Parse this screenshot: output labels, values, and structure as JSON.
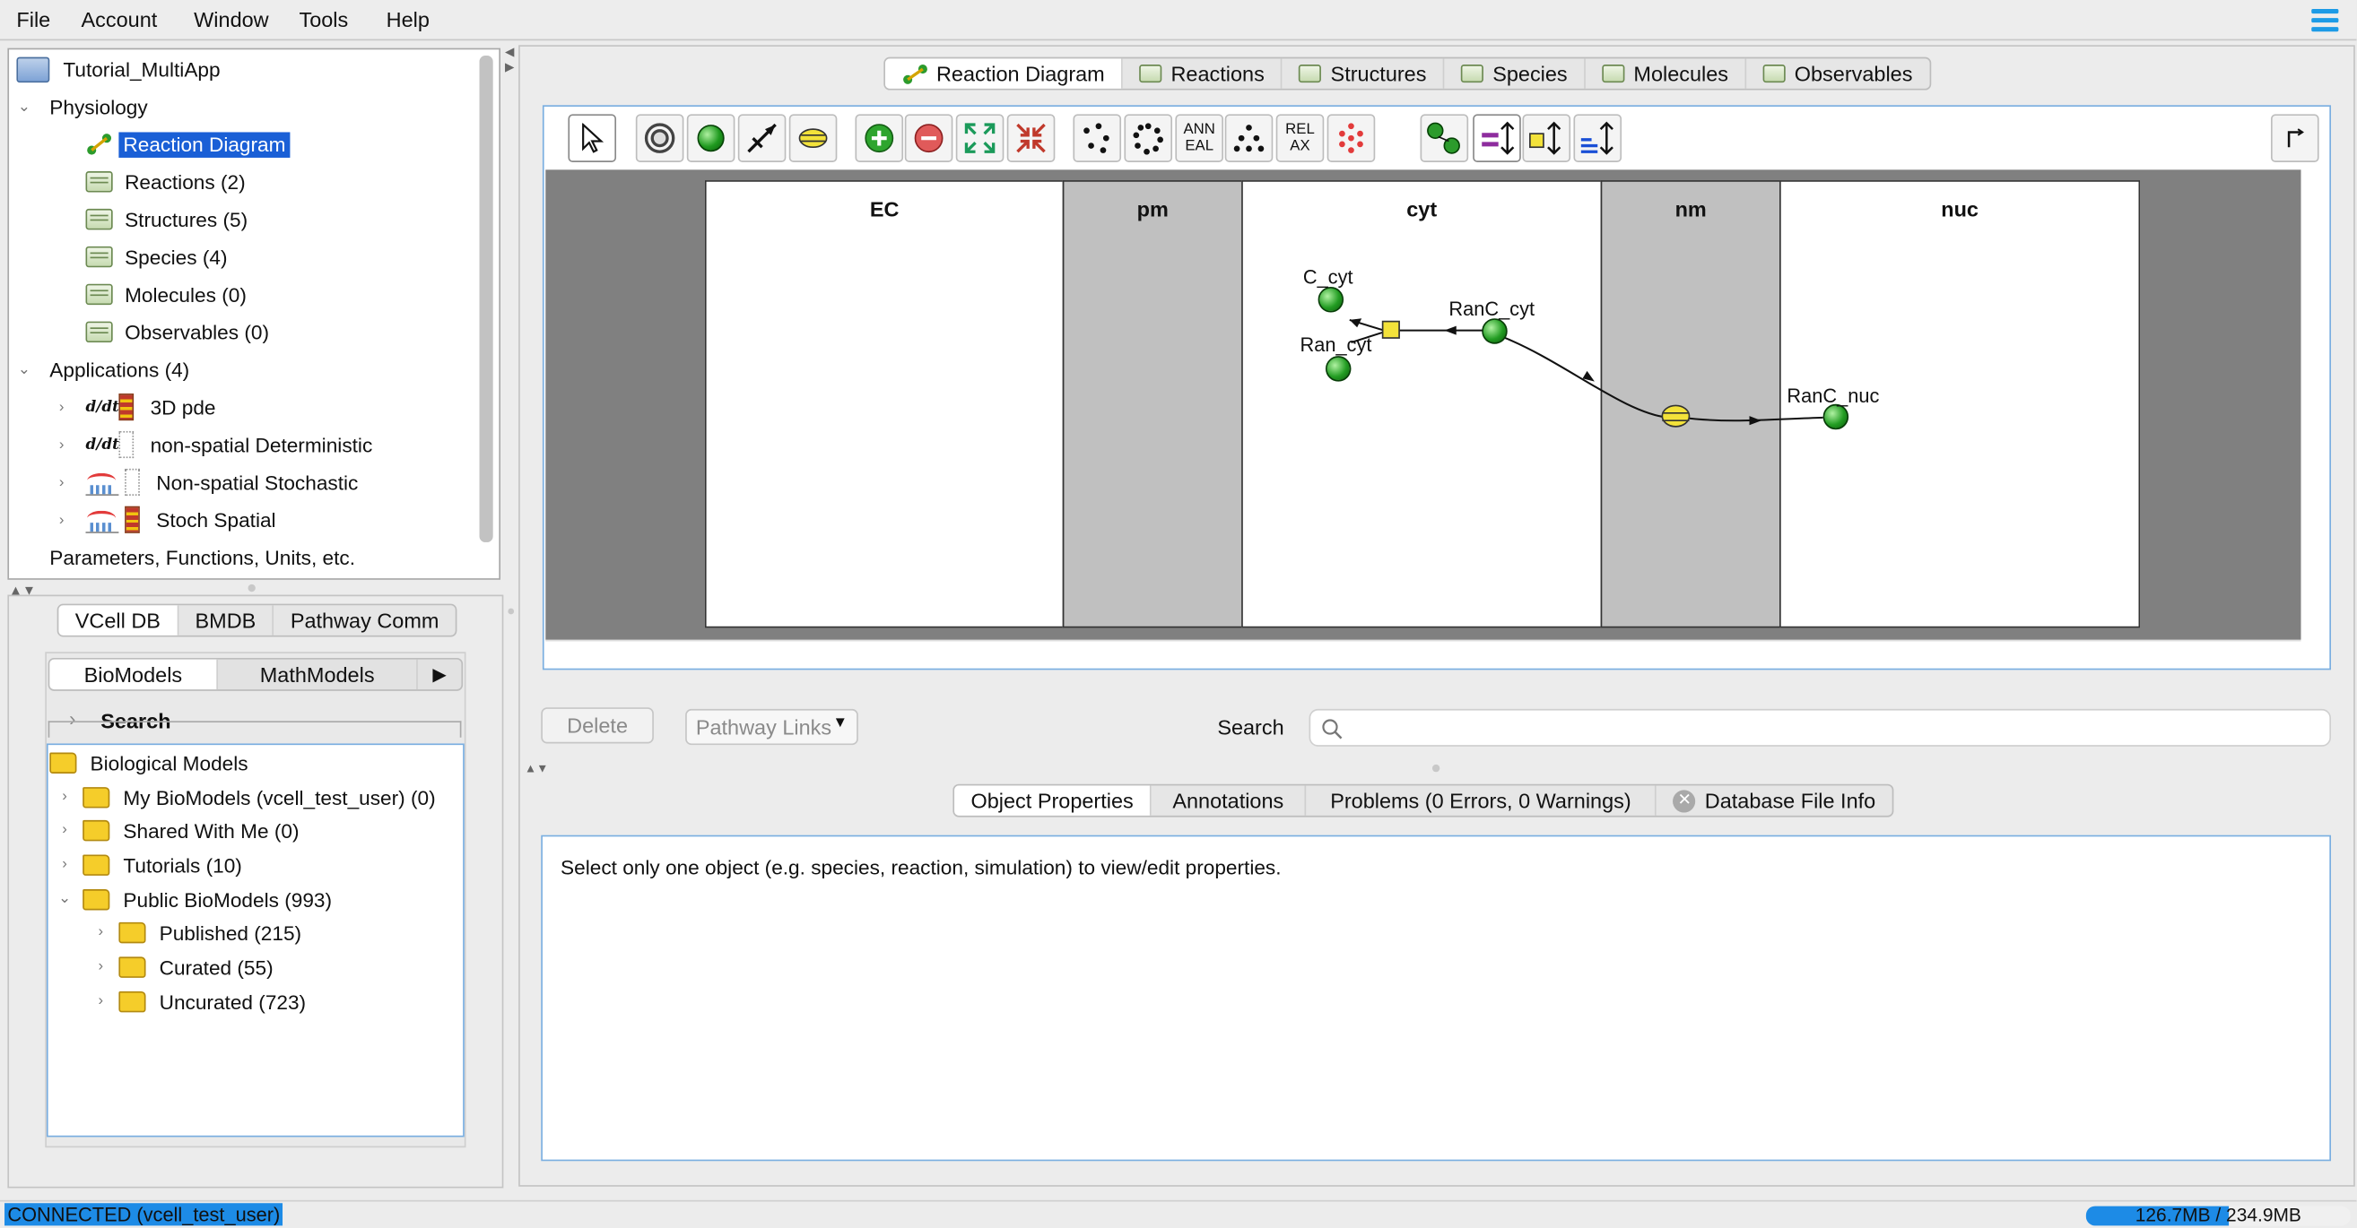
{
  "menubar": {
    "items": [
      "File",
      "Account",
      "Window",
      "Tools",
      "Help"
    ]
  },
  "model_tree": {
    "root": "Tutorial_MultiApp",
    "physiology": {
      "label": "Physiology",
      "items": [
        "Reaction Diagram",
        "Reactions (2)",
        "Structures (5)",
        "Species (4)",
        "Molecules (0)",
        "Observables (0)"
      ],
      "selected": "Reaction Diagram"
    },
    "applications": {
      "label": "Applications (4)",
      "items": [
        "3D pde",
        "non-spatial Deterministic",
        "Non-spatial Stochastic",
        "Stoch Spatial"
      ]
    },
    "parameters": "Parameters, Functions, Units, etc."
  },
  "db_panel": {
    "tabs": [
      "VCell DB",
      "BMDB",
      "Pathway Comm"
    ],
    "subtabs": [
      "BioModels",
      "MathModels"
    ],
    "search_label": "Search",
    "tree": {
      "root": "Biological Models",
      "items": [
        "My BioModels (vcell_test_user) (0)",
        "Shared With Me (0)",
        "Tutorials (10)",
        "Public BioModels (993)"
      ],
      "public_children": [
        "Published (215)",
        "Curated (55)",
        "Uncurated (723)"
      ]
    }
  },
  "main_tabs": [
    "Reaction Diagram",
    "Reactions",
    "Structures",
    "Species",
    "Molecules",
    "Observables"
  ],
  "main_tabs_active": "Reaction Diagram",
  "toolbar": {
    "anneal_label": "ANN\nEAL",
    "relax_label": "REL\nAX"
  },
  "diagram": {
    "compartments": [
      "EC",
      "pm",
      "cyt",
      "nm",
      "nuc"
    ],
    "species": [
      "C_cyt",
      "Ran_cyt",
      "RanC_cyt",
      "RanC_nuc"
    ]
  },
  "actions": {
    "delete": "Delete",
    "pathway_links": "Pathway Links",
    "search_label": "Search",
    "search_placeholder": ""
  },
  "bottom_tabs": [
    "Object Properties",
    "Annotations",
    "Problems (0 Errors, 0 Warnings)",
    "Database File Info"
  ],
  "bottom_tabs_active": "Object Properties",
  "properties_message": "Select only one object (e.g. species, reaction, simulation) to view/edit properties.",
  "status": {
    "connection": "CONNECTED (vcell_test_user)",
    "memory": "126.7MB / 234.9MB",
    "memory_fraction": 0.54
  },
  "colors": {
    "selection": "#1a5fd6",
    "memory_bar": "#1d8be6",
    "membrane": "#c0c0c0",
    "species": "#239d23",
    "flux": "#f3e23a"
  }
}
